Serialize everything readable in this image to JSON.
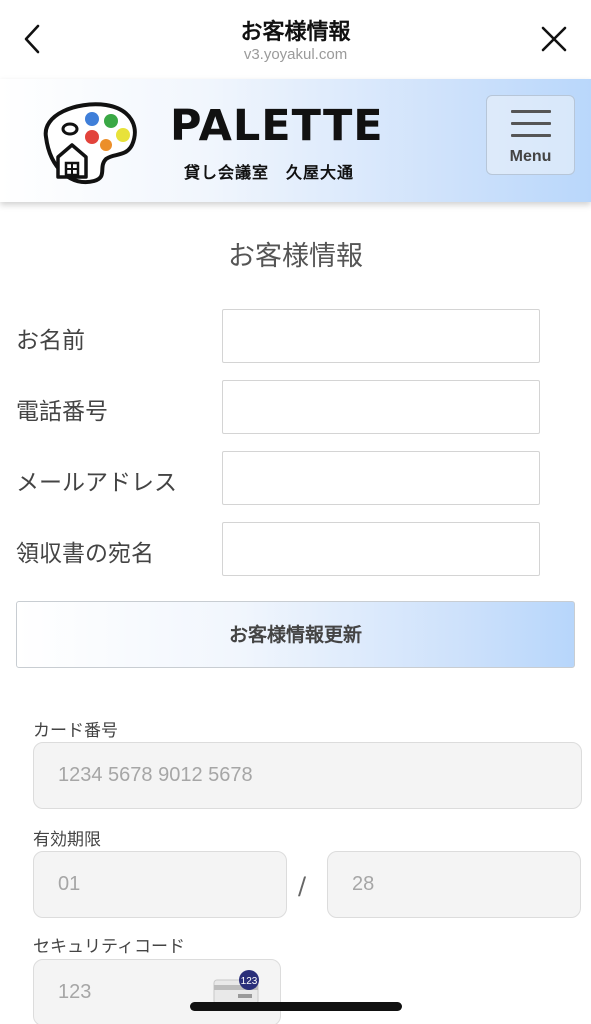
{
  "topbar": {
    "title": "お客様情報",
    "url": "v3.yoyakul.com"
  },
  "header": {
    "brand": "PALETTE",
    "subtitle": "貸し会議室　久屋大通",
    "menu_label": "Menu"
  },
  "section_title": "お客様情報",
  "form": {
    "fields": [
      {
        "label": "お名前",
        "value": ""
      },
      {
        "label": "電話番号",
        "value": ""
      },
      {
        "label": "メールアドレス",
        "value": ""
      },
      {
        "label": "領収書の宛名",
        "value": ""
      }
    ],
    "update_button": "お客様情報更新"
  },
  "card": {
    "number_label": "カード番号",
    "number_placeholder": "1234 5678 9012 5678",
    "expiry_label": "有効期限",
    "expiry_month_placeholder": "01",
    "expiry_separator": "/",
    "expiry_year_placeholder": "28",
    "cvc_label": "セキュリティコード",
    "cvc_placeholder": "123",
    "cvc_icon_text": "123"
  },
  "colors": {
    "banner_gradient_end": "#b9d7fb",
    "input_border": "#d4d4d4",
    "card_input_bg": "#f4f4f4",
    "cvc_badge": "#2a2f7a"
  }
}
